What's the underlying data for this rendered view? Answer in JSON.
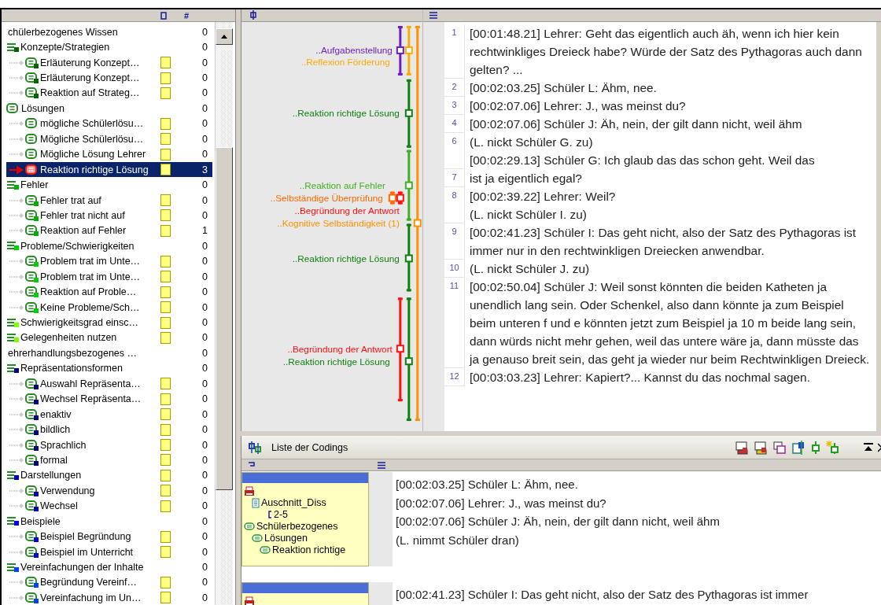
{
  "code_tree": {
    "count_header": "#",
    "items": [
      {
        "label": "chülerbezogenes Wissen",
        "kind": "category",
        "count": "0",
        "swatch": false,
        "selected": false,
        "children": [
          {
            "label": "Konzepte/Strategien",
            "kind": "group",
            "color": "#006400",
            "count": "0",
            "swatch": false,
            "selected": false,
            "children": [
              {
                "label": "Erläuterung Konzept…",
                "kind": "code",
                "color": "#006400",
                "count": "0",
                "swatch": true,
                "selected": false
              },
              {
                "label": "Erläuterung Konzept…",
                "kind": "code",
                "color": "#006400",
                "count": "0",
                "swatch": true,
                "selected": false
              },
              {
                "label": "Reaktion auf Strateg…",
                "kind": "code",
                "color": "#006400",
                "count": "0",
                "swatch": true,
                "selected": false
              }
            ]
          },
          {
            "label": "Lösungen",
            "kind": "plain",
            "count": "0",
            "swatch": false,
            "selected": false,
            "children": [
              {
                "label": "mögliche Schülerlösu…",
                "kind": "plain",
                "count": "0",
                "swatch": true,
                "selected": false
              },
              {
                "label": "Mögliche Schülerlösu…",
                "kind": "plain",
                "count": "0",
                "swatch": true,
                "selected": false
              },
              {
                "label": "Mögliche Lösung Lehrer",
                "kind": "plain",
                "count": "0",
                "swatch": true,
                "selected": false
              },
              {
                "label": "Reaktion richtige Lösung",
                "kind": "plain",
                "count": "3",
                "swatch": true,
                "selected": true
              }
            ]
          },
          {
            "label": "Fehler",
            "kind": "group",
            "color": "#00b000",
            "count": "0",
            "swatch": false,
            "selected": false,
            "children": [
              {
                "label": "Fehler trat auf",
                "kind": "code",
                "color": "#00b000",
                "count": "0",
                "swatch": true,
                "selected": false
              },
              {
                "label": "Fehler trat nicht auf",
                "kind": "code",
                "color": "#00b000",
                "count": "0",
                "swatch": true,
                "selected": false
              },
              {
                "label": "Reaktion auf Fehler",
                "kind": "code",
                "color": "#00b000",
                "count": "1",
                "swatch": true,
                "selected": false
              }
            ]
          },
          {
            "label": "Probleme/Schwierigkeiten",
            "kind": "group",
            "color": "#00d000",
            "count": "0",
            "swatch": false,
            "selected": false,
            "children": [
              {
                "label": "Problem trat im Unte…",
                "kind": "code",
                "color": "#00d000",
                "count": "0",
                "swatch": true,
                "selected": false
              },
              {
                "label": "Problem trat im Unte…",
                "kind": "code",
                "color": "#00d000",
                "count": "0",
                "swatch": true,
                "selected": false
              },
              {
                "label": "Reaktion auf Proble…",
                "kind": "code",
                "color": "#00d000",
                "count": "0",
                "swatch": true,
                "selected": false
              },
              {
                "label": "Keine Probleme/Sch…",
                "kind": "code",
                "color": "#00d000",
                "count": "0",
                "swatch": true,
                "selected": false
              }
            ]
          },
          {
            "label": "Schwierigkeitsgrad einsc…",
            "kind": "group",
            "color": "#80ff00",
            "count": "0",
            "swatch": true,
            "selected": false
          },
          {
            "label": "Gelegenheiten nutzen",
            "kind": "group",
            "color": "#80ff00",
            "count": "0",
            "swatch": true,
            "selected": false
          }
        ]
      },
      {
        "label": "ehrerhandlungsbezogenes …",
        "kind": "category",
        "count": "0",
        "swatch": false,
        "selected": false,
        "children": [
          {
            "label": "Repräsentationsformen",
            "kind": "group",
            "color": "#000080",
            "count": "0",
            "swatch": false,
            "selected": false,
            "children": [
              {
                "label": "Auswahl Repräsenta…",
                "kind": "code",
                "color": "#000080",
                "count": "0",
                "swatch": true,
                "selected": false
              },
              {
                "label": "Wechsel Repräsenta…",
                "kind": "code",
                "color": "#000080",
                "count": "0",
                "swatch": true,
                "selected": false
              },
              {
                "label": "enaktiv",
                "kind": "code",
                "color": "#000080",
                "count": "0",
                "swatch": true,
                "selected": false
              },
              {
                "label": "bildlich",
                "kind": "code",
                "color": "#000080",
                "count": "0",
                "swatch": true,
                "selected": false
              },
              {
                "label": "Sprachlich",
                "kind": "code",
                "color": "#000080",
                "count": "0",
                "swatch": true,
                "selected": false
              },
              {
                "label": "formal",
                "kind": "code",
                "color": "#000080",
                "count": "0",
                "swatch": true,
                "selected": false
              }
            ]
          },
          {
            "label": "Darstellungen",
            "kind": "group",
            "color": "#0000b0",
            "count": "0",
            "swatch": true,
            "selected": false,
            "children": [
              {
                "label": "Verwendung",
                "kind": "code",
                "color": "#0000b0",
                "count": "0",
                "swatch": true,
                "selected": false
              },
              {
                "label": "Wechsel",
                "kind": "code",
                "color": "#0000b0",
                "count": "0",
                "swatch": true,
                "selected": false
              }
            ]
          },
          {
            "label": "Beispiele",
            "kind": "group",
            "color": "#0000e0",
            "count": "0",
            "swatch": false,
            "selected": false,
            "children": [
              {
                "label": "Beispiel Begründung",
                "kind": "code",
                "color": "#0000e0",
                "count": "0",
                "swatch": true,
                "selected": false
              },
              {
                "label": "Beispiel im Unterricht",
                "kind": "code",
                "color": "#0000e0",
                "count": "0",
                "swatch": true,
                "selected": false
              }
            ]
          },
          {
            "label": "Vereinfachungen der Inhalte",
            "kind": "group",
            "color": "#0040ff",
            "count": "0",
            "swatch": false,
            "selected": false,
            "children": [
              {
                "label": "Begründung Vereinf…",
                "kind": "code",
                "color": "#0040ff",
                "count": "0",
                "swatch": true,
                "selected": false
              },
              {
                "label": "Vereinfachung im Un…",
                "kind": "code",
                "color": "#0040ff",
                "count": "0",
                "swatch": true,
                "selected": false
              }
            ]
          }
        ]
      }
    ]
  },
  "stripes": [
    {
      "label": "..Aufgabenstellung",
      "color": "#6a1fc0"
    },
    {
      "label": "..Reflexion Förderung",
      "color": "#ffaa00"
    },
    {
      "label": "..Reaktion richtige Lösung",
      "color": "#108010"
    },
    {
      "label": "..Reaktion auf Fehler",
      "color": "#40b020"
    },
    {
      "label": "..Selbständige Überprüfung",
      "color": "#ff6a00"
    },
    {
      "label": "..Begründung der Antwort",
      "color": "#ff1010"
    },
    {
      "label": "..Kognitive Selbständigkeit (1)",
      "color": "#ff9000"
    },
    {
      "label": "..Reaktion richtige Lösung",
      "color": "#108010"
    },
    {
      "label": "..Begründung der Antwort",
      "color": "#ff1010"
    },
    {
      "label": "..Reaktion richtige Lösung",
      "color": "#108010"
    }
  ],
  "transcript": [
    {
      "number": "1",
      "lines": [
        "[00:01:48.21] Lehrer: Geht das eigentlich auch äh, wenn ich hier kein rechtwinkliges Dreieck habe? Würde der Satz des Pythagoras auch dann gelten? ..."
      ]
    },
    {
      "number": "2",
      "lines": [
        "[00:02:03.25] Schüler L: Ähm, nee."
      ]
    },
    {
      "number": "3",
      "lines": [
        "[00:02:07.06] Lehrer: J., was meinst du?"
      ]
    },
    {
      "number": "4",
      "lines": [
        "[00:02:07.06] Schüler J: Äh, nein, der gilt dann nicht, weil ähm"
      ]
    },
    {
      "number": "6",
      "lines": [
        "(L. nickt Schüler G. zu)",
        "[00:02:29.13] Schüler G: Ich glaub das das schon geht. Weil das"
      ]
    },
    {
      "number": "7",
      "lines": [
        "ist ja eigentlich egal?"
      ]
    },
    {
      "number": "8",
      "lines": [
        "[00:02:39.22] Lehrer: Weil?",
        "(L. nickt Schüler I. zu)"
      ]
    },
    {
      "number": "9",
      "lines": [
        "[00:02:41.23] Schüler I: Das geht nicht, also der Satz des Pythagoras ist immer nur in den rechtwinkligen Dreiecken anwendbar."
      ]
    },
    {
      "number": "10",
      "lines": [
        "(L. nickt Schüler J. zu)"
      ]
    },
    {
      "number": "11",
      "lines": [
        "[00:02:50.04] Schüler J: Weil sonst könnten die beiden Katheten ja unendlich lang sein. Oder Schenkel, also dann könnte ja zum Beispiel beim unteren f und e könnten jetzt zum Beispiel ja 10 m beide lang sein, dann würds nicht mehr gehen, weil das untere wäre ja, dann müsste das ja genauso breit sein, das geht ja wieder nur beim Rechtwinkligen Dreieck."
      ]
    },
    {
      "number": "12",
      "lines": [
        "[00:03:03.23] Lehrer: Kapiert?... Kannst du das nochmal sagen."
      ]
    }
  ],
  "coding_list": {
    "title": "Liste der Codings",
    "codings": [
      {
        "document": "Auschnitt_Diss",
        "segment": "2-5",
        "code_path": [
          "Schülerbezogenes",
          "Lösungen",
          "Reaktion richtige"
        ],
        "lines": [
          "[00:02:03.25] Schüler L: Ähm, nee.",
          "[00:02:07.06] Lehrer: J., was meinst du?",
          "[00:02:07.06] Schüler J: Äh, nein, der gilt dann nicht, weil ähm",
          "(L. nimmt Schüler dran)"
        ]
      },
      {
        "lines": [
          "[00:02:41.23] Schüler I: Das geht nicht, also der Satz des Pythagoras ist immer"
        ]
      }
    ]
  }
}
